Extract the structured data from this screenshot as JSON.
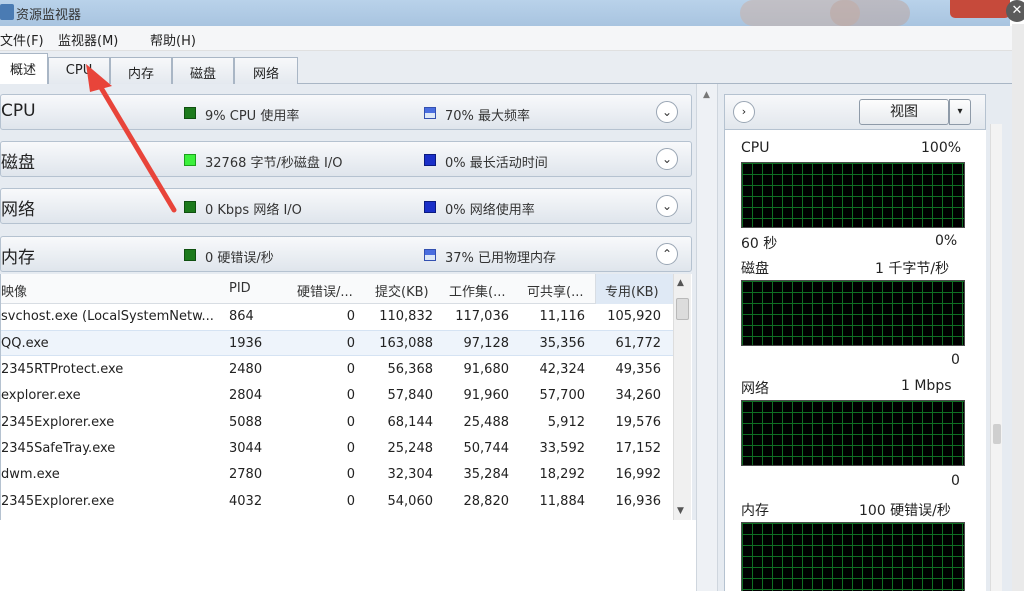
{
  "window": {
    "title": "资源监视器"
  },
  "menu": [
    "文件(F)",
    "监视器(M)",
    "帮助(H)"
  ],
  "tabs": [
    {
      "label": "概述",
      "active": true
    },
    {
      "label": "CPU",
      "active": false
    },
    {
      "label": "内存",
      "active": false
    },
    {
      "label": "磁盘",
      "active": false
    },
    {
      "label": "网络",
      "active": false
    }
  ],
  "sections": {
    "cpu": {
      "title": "CPU",
      "stat1": "9% CPU 使用率",
      "stat2": "70% 最大频率",
      "chevron": "⌄"
    },
    "disk": {
      "title": "磁盘",
      "stat1": "32768 字节/秒磁盘 I/O",
      "stat2": "0% 最长活动时间",
      "chevron": "⌄"
    },
    "network": {
      "title": "网络",
      "stat1": "0 Kbps 网络 I/O",
      "stat2": "0% 网络使用率",
      "chevron": "⌄"
    },
    "memory": {
      "title": "内存",
      "stat1": "0 硬错误/秒",
      "stat2": "37% 已用物理内存",
      "chevron": "⌃"
    }
  },
  "table": {
    "headers": [
      "映像",
      "PID",
      "硬错误/...",
      "提交(KB)",
      "工作集(...",
      "可共享(...",
      "专用(KB)"
    ],
    "rows": [
      [
        "svchost.exe (LocalSystemNetw...",
        "864",
        "0",
        "110,832",
        "117,036",
        "11,116",
        "105,920"
      ],
      [
        "QQ.exe",
        "1936",
        "0",
        "163,088",
        "97,128",
        "35,356",
        "61,772"
      ],
      [
        "2345RTProtect.exe",
        "2480",
        "0",
        "56,368",
        "91,680",
        "42,324",
        "49,356"
      ],
      [
        "explorer.exe",
        "2804",
        "0",
        "57,840",
        "91,960",
        "57,700",
        "34,260"
      ],
      [
        "2345Explorer.exe",
        "5088",
        "0",
        "68,144",
        "25,488",
        "5,912",
        "19,576"
      ],
      [
        "2345SafeTray.exe",
        "3044",
        "0",
        "25,248",
        "50,744",
        "33,592",
        "17,152"
      ],
      [
        "dwm.exe",
        "2780",
        "0",
        "32,304",
        "35,284",
        "18,292",
        "16,992"
      ],
      [
        "2345Explorer.exe",
        "4032",
        "0",
        "54,060",
        "28,820",
        "11,884",
        "16,936"
      ]
    ]
  },
  "right_panel": {
    "view_button": "视图",
    "nav_icon": "›",
    "dropdown_icon": "▾",
    "graphs": [
      {
        "label": "CPU",
        "max": "100%",
        "time": "60 秒",
        "min": "0%"
      },
      {
        "label": "磁盘",
        "max": "1 千字节/秒",
        "min": "0"
      },
      {
        "label": "网络",
        "max": "1 Mbps",
        "min": "0"
      },
      {
        "label": "内存",
        "max": "100 硬错误/秒"
      }
    ]
  },
  "annotation": {
    "color": "#e8443a"
  }
}
